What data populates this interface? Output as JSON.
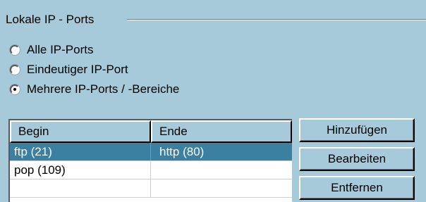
{
  "group": {
    "title": "Lokale IP - Ports"
  },
  "radios": [
    {
      "label": "Alle IP-Ports",
      "checked": false
    },
    {
      "label": "Eindeutiger IP-Port",
      "checked": false
    },
    {
      "label": "Mehrere IP-Ports / -Bereiche",
      "checked": true
    }
  ],
  "list": {
    "columns": [
      "Begin",
      "Ende"
    ],
    "rows": [
      {
        "begin": "ftp (21)",
        "end": "http (80)",
        "selected": true
      },
      {
        "begin": "pop (109)",
        "end": "",
        "selected": false
      },
      {
        "begin": "",
        "end": "",
        "selected": false
      }
    ]
  },
  "buttons": {
    "add": "Hinzufügen",
    "edit": "Bearbeiten",
    "remove": "Entfernen"
  },
  "colors": {
    "background": "#a6cad9",
    "selection": "#3b7fa1"
  }
}
